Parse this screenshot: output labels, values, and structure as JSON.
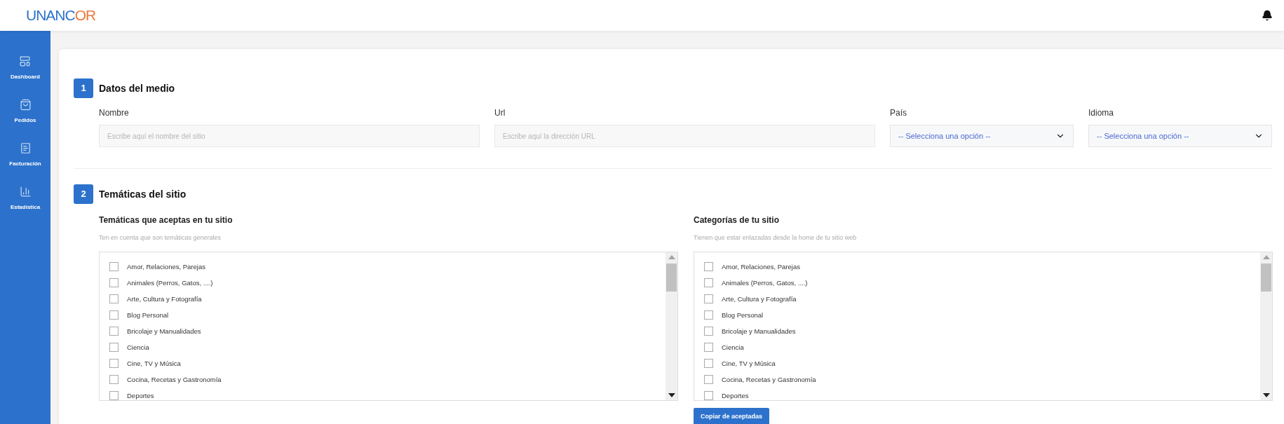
{
  "header": {
    "logo": "UNANCOR"
  },
  "sidebar": {
    "items": [
      {
        "label": "Dashboard"
      },
      {
        "label": "Pedidos"
      },
      {
        "label": "Facturación"
      },
      {
        "label": "Estadística"
      }
    ]
  },
  "sections": [
    {
      "number": "1",
      "title": "Datos del medio",
      "fields": [
        {
          "kind": "text",
          "label": "Nombre",
          "placeholder": "Escribe aquí el nombre del sitio"
        },
        {
          "kind": "text",
          "label": "Url",
          "placeholder": "Escribe aquí la dirección URL"
        },
        {
          "kind": "select",
          "label": "País",
          "value": "-- Selecciona una opción --"
        },
        {
          "kind": "select",
          "label": "Idioma",
          "value": "-- Selecciona una opción --"
        }
      ]
    },
    {
      "number": "2",
      "title": "Temáticas del sitio",
      "groups": [
        {
          "title": "Temáticas que aceptas en tu sitio",
          "hint": "Ten en cuenta que son temáticas generales",
          "options": [
            {
              "label": "Amor, Relaciones, Parejas",
              "checked": false
            },
            {
              "label": "Animales (Perros, Gatos, ....)",
              "checked": false
            },
            {
              "label": "Arte, Cultura y Fotografía",
              "checked": false
            },
            {
              "label": "Blog Personal",
              "checked": false
            },
            {
              "label": "Bricolaje y Manualidades",
              "checked": false
            },
            {
              "label": "Ciencia",
              "checked": false
            },
            {
              "label": "Cine, TV y Música",
              "checked": false
            },
            {
              "label": "Cocina, Recetas y Gastronomía",
              "checked": false
            },
            {
              "label": "Deportes",
              "checked": false
            }
          ]
        },
        {
          "title": "Categorías de tu sitio",
          "hint": "Tienen que estar enlazadas desde la home de tu sitio web",
          "options": [
            {
              "label": "Amor, Relaciones, Parejas",
              "checked": false
            },
            {
              "label": "Animales (Perros, Gatos, ....)",
              "checked": false
            },
            {
              "label": "Arte, Cultura y Fotografía",
              "checked": false
            },
            {
              "label": "Blog Personal",
              "checked": false
            },
            {
              "label": "Bricolaje y Manualidades",
              "checked": false
            },
            {
              "label": "Ciencia",
              "checked": false
            },
            {
              "label": "Cine, TV y Música",
              "checked": false
            },
            {
              "label": "Cocina, Recetas y Gastronomía",
              "checked": false
            },
            {
              "label": "Deportes",
              "checked": false
            }
          ],
          "button": "Copiar de aceptadas"
        }
      ]
    }
  ]
}
